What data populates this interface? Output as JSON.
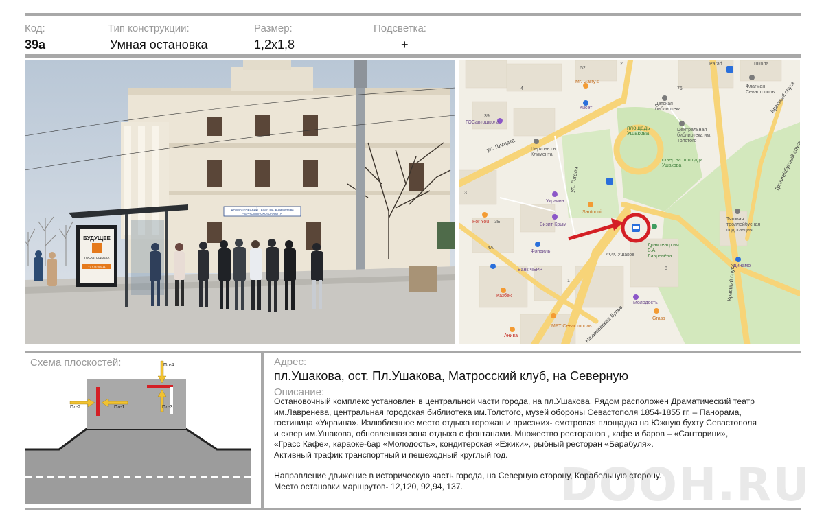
{
  "header": {
    "code_label": "Код:",
    "type_label": "Тип конструкции:",
    "size_label": "Размер:",
    "light_label": "Подсветка:",
    "code_value": "39а",
    "type_value": "Умная остановка",
    "size_value": "1,2х1,8",
    "light_value": "+"
  },
  "photo": {
    "theatre_sign_line1": "ДРАМАТИЧЕСКИЙ ТЕАТР им. Б.Лавренёва",
    "theatre_sign_line2": "ЧЕРНОМОРСКОГО ФЛОТА",
    "billboard_title": "БУДУЩЕЕ",
    "billboard_brand": "ГОСАВТОШКОЛА",
    "billboard_phone": "+7 978 000-11"
  },
  "map": {
    "labels": [
      "52",
      "Mr. Garry's",
      "Кисет",
      "4",
      "39",
      "ГОСавтошкола",
      "ул. Шмидта",
      "Церковь св. Климента",
      "Детская библиотека",
      "76",
      "площадь Ушакова",
      "Центральная библиотека им. Толстого",
      "сквер на площади Ушакова",
      "Красный спуск",
      "Троллейбусный спуск",
      "Флагман Севастополь",
      "Parad",
      "Школа",
      "ул. Гоголя",
      "Украина",
      "Santorini",
      "For You",
      "3",
      "Визит-Крым",
      "3Б",
      "4А",
      "Фонвиль",
      "Ф.Ф. Ушаков",
      "Драмтеатр им. Б.А. Лавренёва",
      "Банк ЧБРР",
      "Казбек",
      "Молодость",
      "МРТ Севастополь",
      "Grass",
      "Анива",
      "Тяговая троллейбусная подстанция",
      "Динамо",
      "Красный спуск",
      "Нахимовский бульв.",
      "1",
      "2",
      "8"
    ]
  },
  "scheme": {
    "title": "Схема плоскостей:",
    "planes": [
      "Пл-4",
      "Пл-2",
      "Пл-1",
      "Пл-3"
    ]
  },
  "address": {
    "label": "Адрес:",
    "value": "пл.Ушакова, ост. Пл.Ушакова, Матросский клуб, на Северную"
  },
  "description": {
    "label": "Описание:",
    "lines": [
      "Остановочный комплекс  установлен в центральной части  города, на пл.Ушакова. Рядом расположен Драматический театр",
      "им.Лавренева,  центральная городская библиотека им.Толстого, музей обороны Севастополя 1854-1855 гг. – Панорама,",
      "гостиница «Украина». Излюбленное место отдыха горожан и приезжих- смотровая площадка на Южную бухту Севастополя",
      "и сквер им.Ушакова, обновленная зона отдыха с фонтанами. Множество ресторанов , кафе и баров – «Санторини»,",
      "«Грасс Кафе», караоке-бар «Молодость», кондитерская «Ежики»,  рыбный ресторан «Барабуля».",
      "Активный трафик транспортный и пешеходный круглый год."
    ],
    "lines2": [
      "Направление движение в историческую часть города, на Северную сторону, Корабельную сторону.",
      "Место остановки маршрутов- 12,120, 92,94, 137."
    ]
  },
  "watermark": "DOOH.RU"
}
